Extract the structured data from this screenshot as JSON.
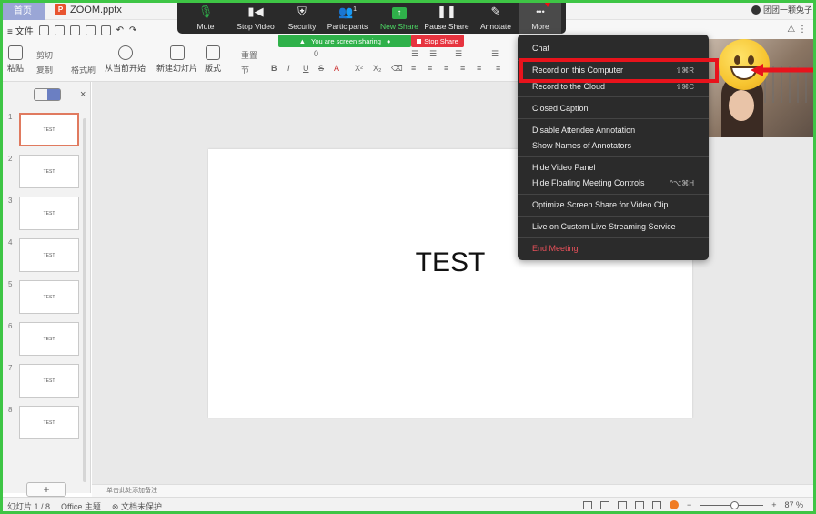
{
  "titlebar": {
    "home_tab": "首页",
    "doc_icon": "P",
    "doc_name": "ZOOM.pptx",
    "user_name": "团团一颗兔子"
  },
  "menurow": {
    "file_menu": "≡ 文件",
    "right_icon": "⚠ ⋮"
  },
  "ribbon": {
    "paste": "粘贴",
    "cut": "剪切",
    "copy": "复制",
    "format": "格式刷",
    "from_start": "从当前开始",
    "new_slide": "新建幻灯片",
    "layout": "版式",
    "section": "节",
    "reset": "重置",
    "font_size": "0"
  },
  "panel": {
    "close": "×",
    "add": "+",
    "slides": [
      {
        "num": "1",
        "label": "TEST"
      },
      {
        "num": "2",
        "label": "TEST"
      },
      {
        "num": "3",
        "label": "TEST"
      },
      {
        "num": "4",
        "label": "TEST"
      },
      {
        "num": "5",
        "label": "TEST"
      },
      {
        "num": "6",
        "label": "TEST"
      },
      {
        "num": "7",
        "label": "TEST"
      },
      {
        "num": "8",
        "label": "TEST"
      }
    ]
  },
  "slide": {
    "text": "TEST"
  },
  "notes": {
    "placeholder": "单击此处添加备注"
  },
  "statusbar": {
    "slide_count": "幻灯片 1 / 8",
    "theme": "Office 主题",
    "protect": "文档未保护",
    "zoom_minus": "−",
    "zoom_plus": "+",
    "zoom": "87 %"
  },
  "zoombar": {
    "mute": "Mute",
    "stop_video": "Stop Video",
    "security": "Security",
    "participants": "Participants",
    "participants_count": "1",
    "new_share": "New Share",
    "pause_share": "Pause Share",
    "annotate": "Annotate",
    "more": "More",
    "more_glyph": "•••"
  },
  "share_banner": {
    "text": "You are screen sharing",
    "stop": "Stop Share"
  },
  "dropdown": {
    "items": [
      {
        "label": "Chat",
        "shortcut": ""
      },
      {
        "label": "Record on this Computer",
        "shortcut": "⇧⌘R"
      },
      {
        "label": "Record to the Cloud",
        "shortcut": "⇧⌘C"
      },
      {
        "label": "Closed Caption",
        "shortcut": ""
      },
      {
        "label": "Disable Attendee Annotation",
        "shortcut": ""
      },
      {
        "label": "Show Names of Annotators",
        "shortcut": ""
      },
      {
        "label": "Hide Video Panel",
        "shortcut": ""
      },
      {
        "label": "Hide Floating Meeting Controls",
        "shortcut": "^⌥⌘H"
      },
      {
        "label": "Optimize Screen Share for Video Clip",
        "shortcut": ""
      },
      {
        "label": "Live on Custom Live Streaming Service",
        "shortcut": ""
      },
      {
        "label": "End Meeting",
        "shortcut": ""
      }
    ]
  },
  "colors": {
    "share_green": "#3ec545",
    "highlight_red": "#e8131c",
    "menu_bg": "#2b2b2b",
    "end_meeting": "#e7505a"
  }
}
